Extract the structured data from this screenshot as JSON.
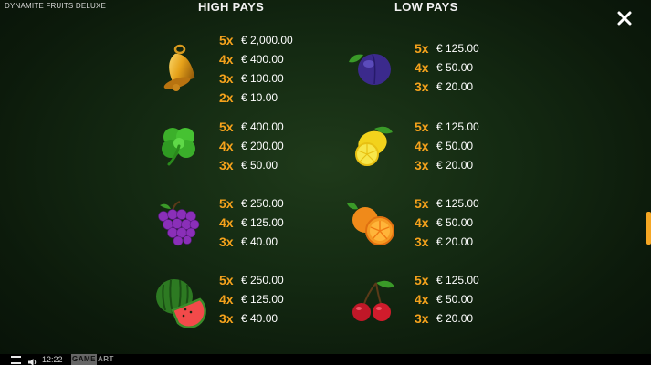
{
  "game_title": "DYNAMITE FRUITS DELUXE",
  "headers": {
    "high": "HIGH PAYS",
    "low": "LOW PAYS"
  },
  "close_icon": "close-icon",
  "high_pays": [
    {
      "symbol": "bell",
      "pays": [
        {
          "mult": "5x",
          "value": "€ 2,000.00"
        },
        {
          "mult": "4x",
          "value": "€ 400.00"
        },
        {
          "mult": "3x",
          "value": "€ 100.00"
        },
        {
          "mult": "2x",
          "value": "€ 10.00"
        }
      ]
    },
    {
      "symbol": "clover",
      "pays": [
        {
          "mult": "5x",
          "value": "€ 400.00"
        },
        {
          "mult": "4x",
          "value": "€ 200.00"
        },
        {
          "mult": "3x",
          "value": "€ 50.00"
        }
      ]
    },
    {
      "symbol": "grapes",
      "pays": [
        {
          "mult": "5x",
          "value": "€ 250.00"
        },
        {
          "mult": "4x",
          "value": "€ 125.00"
        },
        {
          "mult": "3x",
          "value": "€ 40.00"
        }
      ]
    },
    {
      "symbol": "watermelon",
      "pays": [
        {
          "mult": "5x",
          "value": "€ 250.00"
        },
        {
          "mult": "4x",
          "value": "€ 125.00"
        },
        {
          "mult": "3x",
          "value": "€ 40.00"
        }
      ]
    }
  ],
  "low_pays": [
    {
      "symbol": "plum",
      "pays": [
        {
          "mult": "5x",
          "value": "€ 125.00"
        },
        {
          "mult": "4x",
          "value": "€ 50.00"
        },
        {
          "mult": "3x",
          "value": "€ 20.00"
        }
      ]
    },
    {
      "symbol": "lemon",
      "pays": [
        {
          "mult": "5x",
          "value": "€ 125.00"
        },
        {
          "mult": "4x",
          "value": "€ 50.00"
        },
        {
          "mult": "3x",
          "value": "€ 20.00"
        }
      ]
    },
    {
      "symbol": "orange",
      "pays": [
        {
          "mult": "5x",
          "value": "€ 125.00"
        },
        {
          "mult": "4x",
          "value": "€ 50.00"
        },
        {
          "mult": "3x",
          "value": "€ 20.00"
        }
      ]
    },
    {
      "symbol": "cherries",
      "pays": [
        {
          "mult": "5x",
          "value": "€ 125.00"
        },
        {
          "mult": "4x",
          "value": "€ 50.00"
        },
        {
          "mult": "3x",
          "value": "€ 20.00"
        }
      ]
    }
  ],
  "bottom_bar": {
    "menu_icon": "hamburger-menu-icon",
    "sound_icon": "speaker-icon",
    "clock": "12:22",
    "provider_logo_left": "GAME",
    "provider_logo_right": "ART"
  },
  "colors": {
    "multiplier": "#f5a21c",
    "scroll_indicator": "#f5a623",
    "background": "#142a12"
  }
}
